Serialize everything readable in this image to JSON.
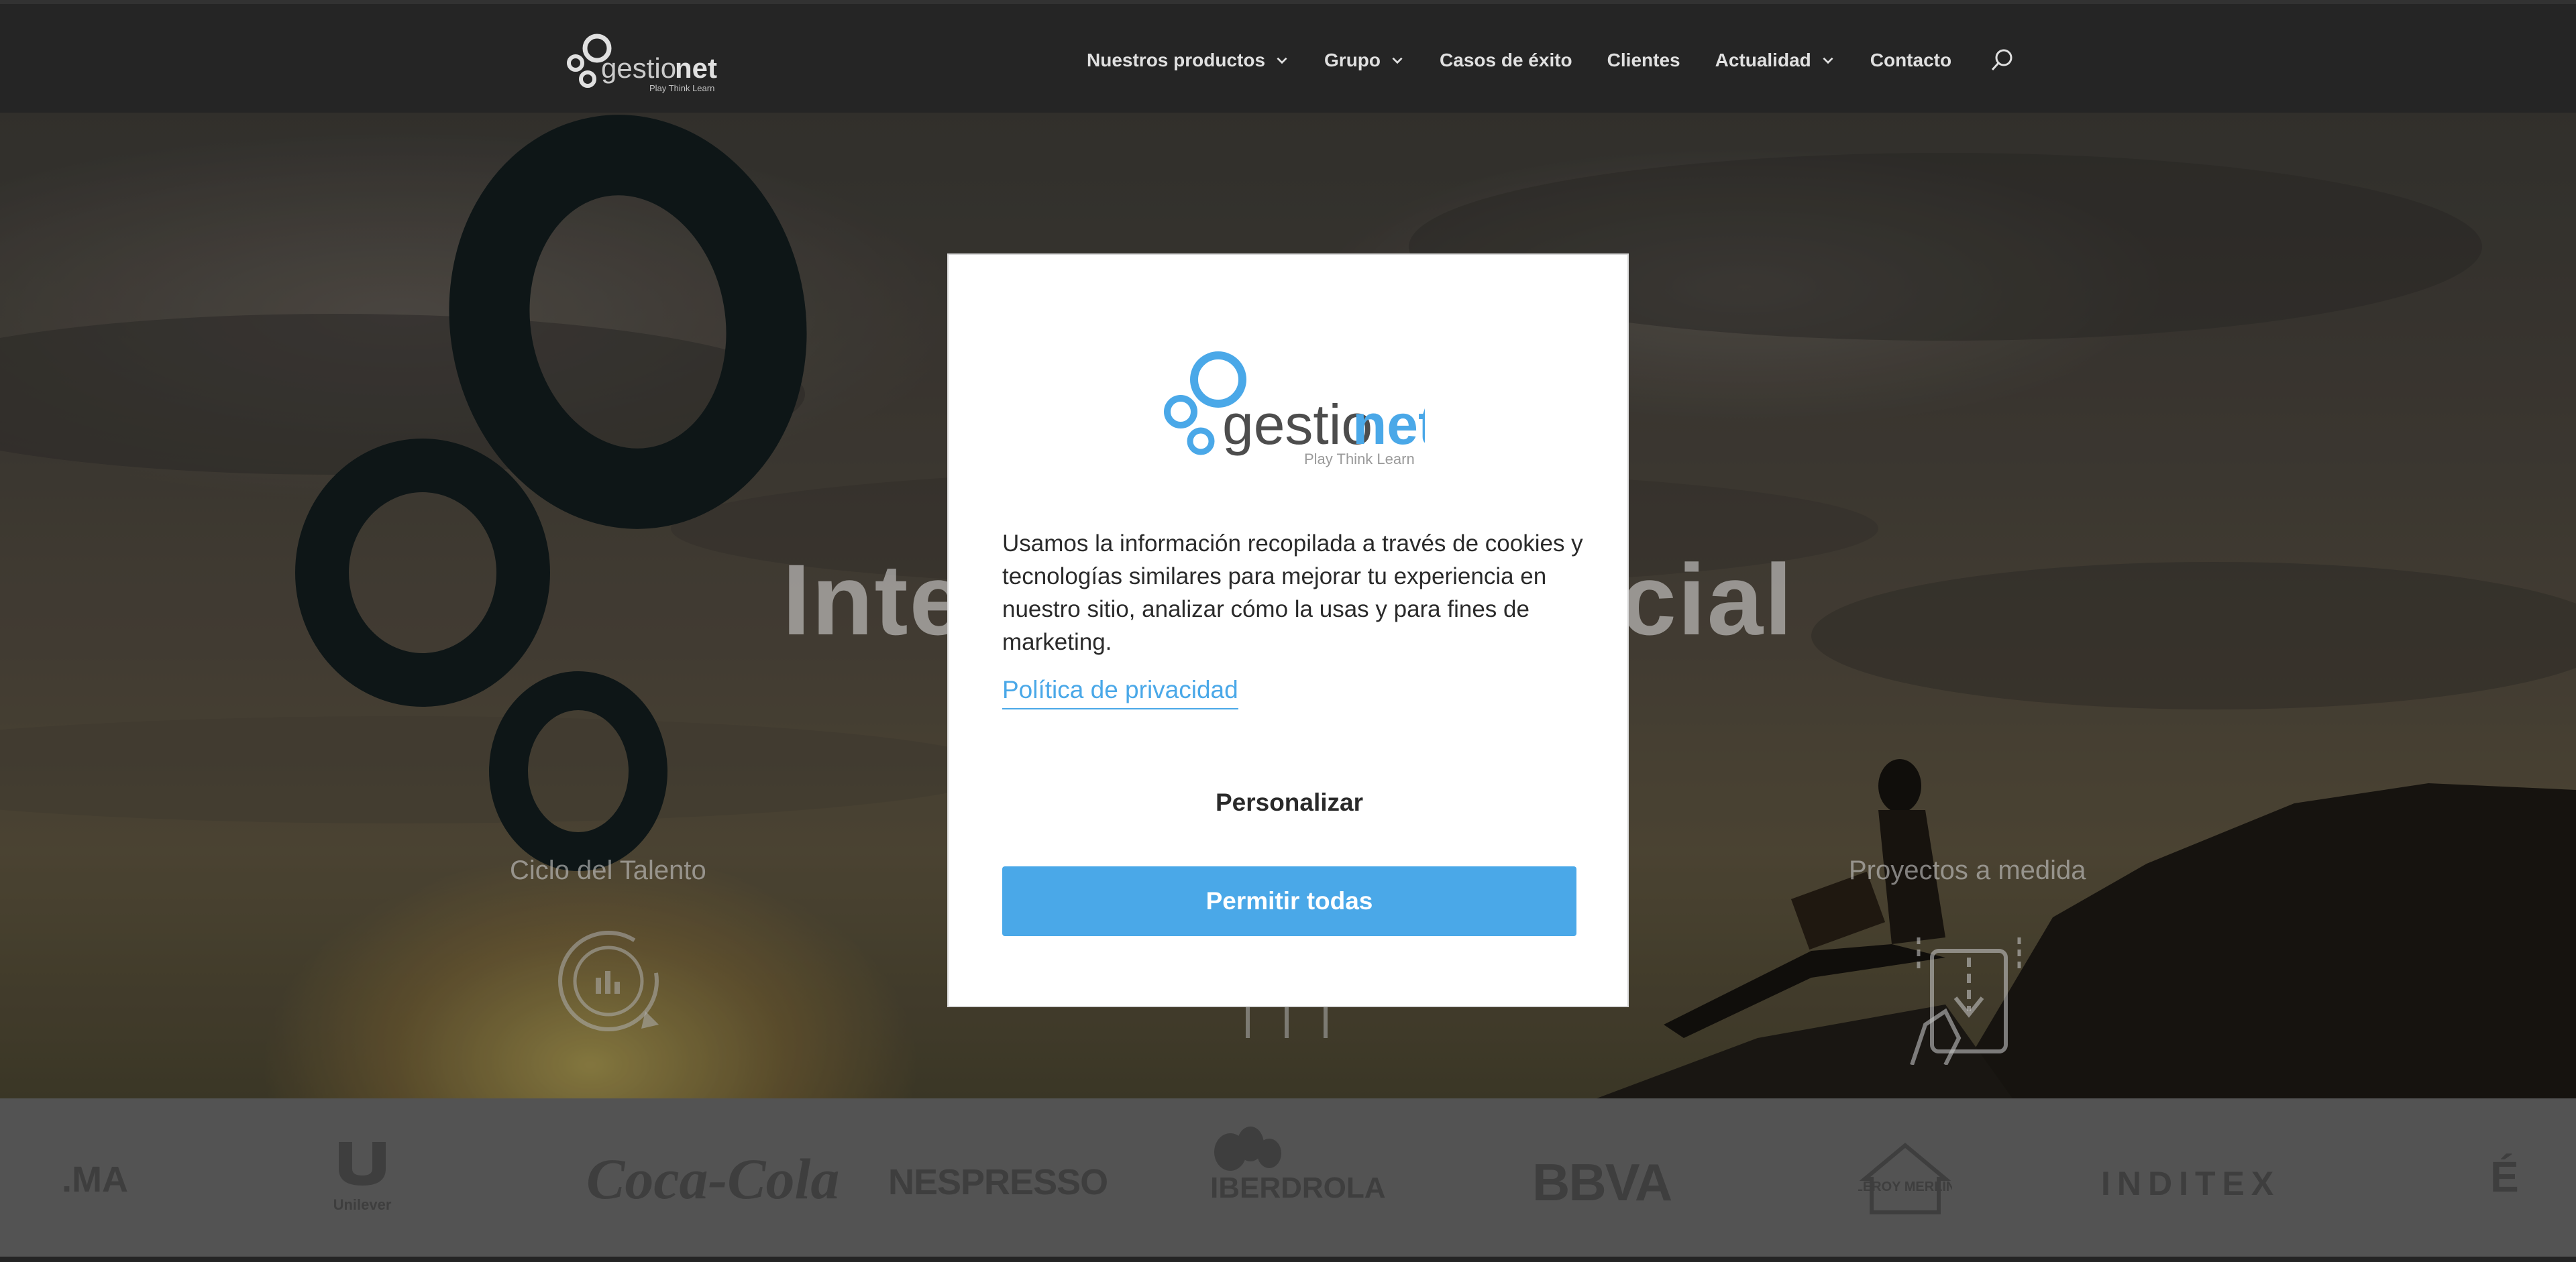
{
  "header": {
    "logo_text_left": "gestio",
    "logo_text_right": "net",
    "logo_tagline": "Play  Think  Learn",
    "nav": [
      {
        "label": "Nuestros productos",
        "has_dropdown": true
      },
      {
        "label": "Grupo",
        "has_dropdown": true
      },
      {
        "label": "Casos de éxito",
        "has_dropdown": false
      },
      {
        "label": "Clientes",
        "has_dropdown": false
      },
      {
        "label": "Actualidad",
        "has_dropdown": true
      },
      {
        "label": "Contacto",
        "has_dropdown": false
      }
    ],
    "search_icon": "search-icon"
  },
  "hero": {
    "title": "Inteligencia Artificial",
    "services": [
      {
        "label": "Ciclo del Talento",
        "icon": "analytics-cycle-icon"
      },
      {
        "label": "",
        "icon": "people-network-icon"
      },
      {
        "label": "Proyectos a medida",
        "icon": "tablet-hand-icon"
      }
    ]
  },
  "clients": [
    ".MA",
    "Unilever",
    "Coca-Cola",
    "NESPRESSO",
    "IBERDROLA",
    "BBVA",
    "LEROY MERLIN",
    "INDITEX",
    "É"
  ],
  "modal": {
    "logo_text_left": "gestio",
    "logo_text_right": "net",
    "logo_tagline": "Play  Think  Learn",
    "message": "Usamos la información recopilada a través de cookies y tecnologías similares para mejorar tu experiencia en nuestro sitio, analizar cómo la usas y para fines de marketing.",
    "privacy_link": "Política de privacidad",
    "customize_label": "Personalizar",
    "allow_all_label": "Permitir todas"
  },
  "colors": {
    "accent": "#4aa8e8",
    "header_bg": "#2b2b2b",
    "clients_bg": "#5f5f5f",
    "text_dark": "#2a2a2a"
  }
}
